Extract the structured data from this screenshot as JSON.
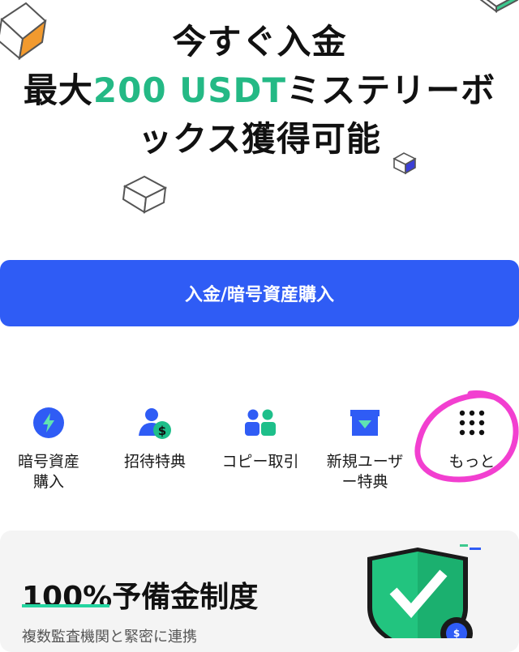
{
  "hero": {
    "line1": "今すぐ入金",
    "line2_prefix": "最大",
    "line2_accent": "200 USDT",
    "line2_suffix": "ミステリーボ",
    "line3": "ックス獲得可能"
  },
  "cta": {
    "label": "入金/暗号資産購入"
  },
  "quick_actions": [
    {
      "label_line1": "暗号資産",
      "label_line2": "購入",
      "icon": "lightning-icon"
    },
    {
      "label_line1": "招待特典",
      "label_line2": "",
      "icon": "user-dollar-icon"
    },
    {
      "label_line1": "コピー取引",
      "label_line2": "",
      "icon": "people-icon"
    },
    {
      "label_line1": "新規ユーザ",
      "label_line2": "ー特典",
      "icon": "gift-box-icon"
    },
    {
      "label_line1": "もっと",
      "label_line2": "",
      "icon": "grid-dots-icon"
    }
  ],
  "reserve_card": {
    "title": "100%予備金制度",
    "subtitle": "複数監査機関と緊密に連携"
  },
  "colors": {
    "accent_green": "#24b985",
    "primary_blue": "#2f5cf5",
    "annotation_pink": "#f23fd0"
  }
}
